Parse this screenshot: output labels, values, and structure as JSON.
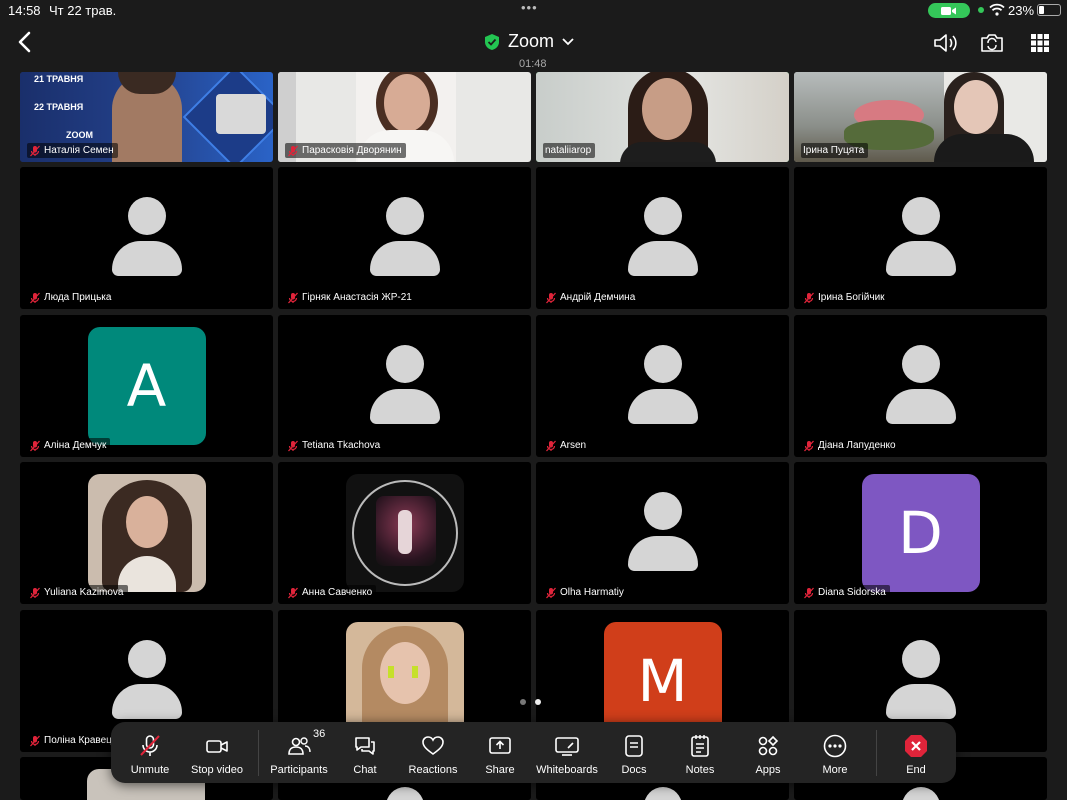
{
  "status_bar": {
    "time": "14:58",
    "date": "Чт 22 трав.",
    "battery": "23%",
    "battery_level": 0.23
  },
  "header": {
    "title": "Zoom",
    "elapsed": "01:48"
  },
  "icons": {
    "back": "chevron-left-icon",
    "shield": "shield-check-icon",
    "speaker": "speaker-icon",
    "camera_flip": "camera-flip-icon",
    "grid": "grid-icon"
  },
  "colors": {
    "active_speaker": "#23c552",
    "end_button": "#e0243a",
    "avatar_a": "#00897b",
    "avatar_d": "#7e57c2",
    "avatar_m": "#d03e1a"
  },
  "participants": [
    {
      "name": "Наталія Семен",
      "muted": true,
      "kind": "video"
    },
    {
      "name": "Парасковія Дворянин",
      "muted": true,
      "kind": "video"
    },
    {
      "name": "nataliiarop",
      "muted": false,
      "kind": "video",
      "active": true
    },
    {
      "name": "Ірина Пуцята",
      "muted": false,
      "kind": "video"
    },
    {
      "name": "Люда Прицька",
      "muted": true,
      "kind": "placeholder"
    },
    {
      "name": "Гірняк Анастасія ЖР-21",
      "muted": true,
      "kind": "placeholder"
    },
    {
      "name": "Андрій Демчина",
      "muted": true,
      "kind": "placeholder"
    },
    {
      "name": "Ірина Богійчик",
      "muted": true,
      "kind": "placeholder"
    },
    {
      "name": "Аліна Демчук",
      "muted": true,
      "kind": "letter",
      "letter": "A"
    },
    {
      "name": "Tetiana Tkachova",
      "muted": true,
      "kind": "placeholder"
    },
    {
      "name": "Arsen",
      "muted": true,
      "kind": "placeholder"
    },
    {
      "name": "Діана Лапуденко",
      "muted": true,
      "kind": "placeholder"
    },
    {
      "name": "Yuliana Kazimova",
      "muted": true,
      "kind": "photo"
    },
    {
      "name": "Анна Савченко",
      "muted": true,
      "kind": "photo"
    },
    {
      "name": "Olha Harmatiy",
      "muted": true,
      "kind": "placeholder"
    },
    {
      "name": "Diana Sidorska",
      "muted": true,
      "kind": "letter",
      "letter": "D"
    },
    {
      "name": "Поліна Кравец",
      "muted": true,
      "kind": "placeholder"
    },
    {
      "name": "",
      "muted": false,
      "kind": "photo"
    },
    {
      "name": "",
      "muted": false,
      "kind": "letter",
      "letter": "M"
    },
    {
      "name": "",
      "muted": false,
      "kind": "placeholder"
    }
  ],
  "first_tile_overlay": {
    "line1": "21 ТРАВНЯ",
    "line2": "22 ТРАВНЯ",
    "line3": "ZOOM"
  },
  "pagination": {
    "pages": 2,
    "current": 2
  },
  "toolbar": {
    "unmute": "Unmute",
    "stop_video": "Stop video",
    "participants": "Participants",
    "participants_count": "36",
    "chat": "Chat",
    "reactions": "Reactions",
    "share": "Share",
    "whiteboards": "Whiteboards",
    "docs": "Docs",
    "notes": "Notes",
    "apps": "Apps",
    "more": "More",
    "end": "End"
  }
}
